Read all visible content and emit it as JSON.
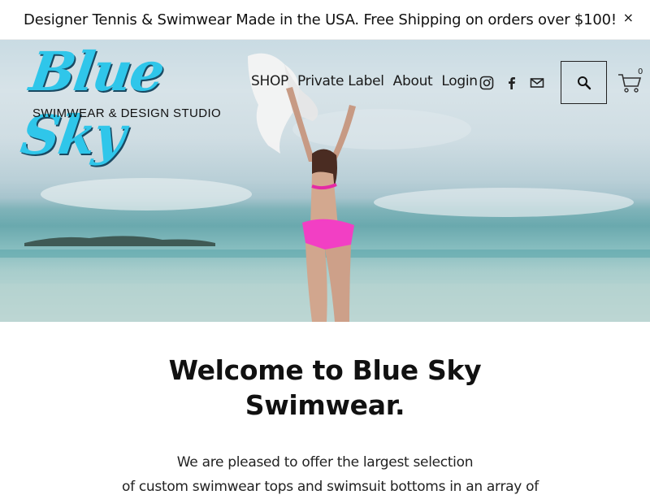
{
  "announcement": {
    "text": "Designer Tennis & Swimwear Made in the USA. Free Shipping on orders over $100!",
    "close_glyph": "×"
  },
  "brand": {
    "logo_script": "Blue Sky",
    "logo_subtitle": "SWIMWEAR & DESIGN STUDIO",
    "accent_color": "#2fc6ea"
  },
  "nav": {
    "items": [
      {
        "label": "SHOP"
      },
      {
        "label": "Private Label"
      },
      {
        "label": "About"
      },
      {
        "label": "Login"
      }
    ],
    "social": [
      "instagram-icon",
      "facebook-icon",
      "email-icon"
    ],
    "search_icon": "search-icon",
    "cart": {
      "icon": "cart-icon",
      "count": "0"
    }
  },
  "hero": {
    "image_alt": "Woman in pink bikini holding a white scarf on a beach"
  },
  "main": {
    "welcome_line1": "Welcome to Blue Sky",
    "welcome_line2": "Swimwear.",
    "intro_line1": "We are pleased to offer the largest selection",
    "intro_line2": "of custom swimwear tops and swimsuit bottoms in an array of"
  }
}
